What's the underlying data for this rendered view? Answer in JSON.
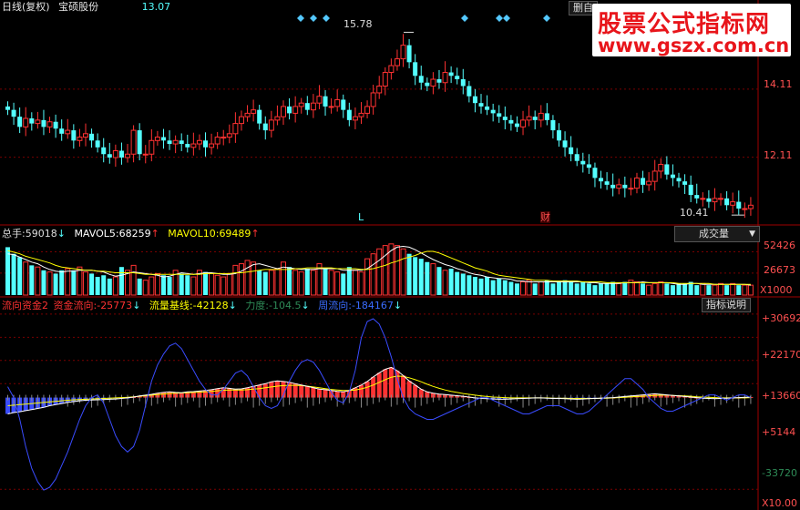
{
  "header": {
    "period": "日线(复权)",
    "stock_name": "宝硕股份",
    "price_value": "13.07",
    "right_button": "删自"
  },
  "main_panel": {
    "y_ticks": [
      "14.11",
      "12.11"
    ],
    "high_label": "15.78",
    "low_label": "10.41",
    "marker_L": "L",
    "marker_cai": "财"
  },
  "volume_panel": {
    "label_total": "总手:",
    "total_value": "59018",
    "label_ma5": "MAVOL5:",
    "ma5_value": "68259",
    "label_ma10": "MAVOL10:",
    "ma10_value": "69489",
    "dropdown": "成交量",
    "y_ticks": [
      "52426",
      "26673"
    ],
    "unit": "X1000"
  },
  "indicator_panel": {
    "label_fund2": "流向资金2",
    "label_flow": "资金流向:",
    "flow_value": "-25773",
    "label_base": "流量基线:",
    "base_value": "-42128",
    "label_force": "力度:",
    "force_value": "-104.5",
    "label_week": "周流向:",
    "week_value": "-184167",
    "explain_button": "指标说明",
    "y_ticks": [
      "+30692",
      "+22170",
      "+13660",
      "+5144",
      "-33720"
    ],
    "unit": "X10.00"
  },
  "watermark": {
    "line1": "股票公式指标网",
    "line2": "www.gszx.com.cn"
  },
  "colors": {
    "up": "#ff3232",
    "down": "#54ffff",
    "ma5": "#ffffff",
    "ma10": "#ffff00",
    "week": "#3a4cff",
    "grid": "#7a0000",
    "arrow_up": "#ff3232",
    "arrow_down": "#54ffff"
  },
  "chart_data": [
    {
      "type": "candlestick",
      "title": "日线(复权) 宝硕股份",
      "close": [
        13.5,
        13.3,
        13.0,
        13.25,
        13.1,
        13.2,
        13.0,
        13.15,
        12.95,
        12.8,
        12.9,
        12.6,
        12.7,
        12.8,
        12.6,
        12.4,
        12.2,
        12.1,
        12.3,
        12.1,
        12.2,
        12.9,
        12.2,
        12.2,
        12.6,
        12.7,
        12.6,
        12.5,
        12.6,
        12.5,
        12.4,
        12.5,
        12.6,
        12.4,
        12.5,
        12.7,
        12.7,
        12.8,
        13.1,
        13.3,
        13.4,
        13.5,
        13.1,
        12.9,
        13.2,
        13.3,
        13.6,
        13.4,
        13.6,
        13.7,
        13.5,
        13.7,
        13.9,
        13.6,
        13.6,
        13.8,
        13.5,
        13.2,
        13.3,
        13.4,
        13.6,
        14.0,
        14.2,
        14.6,
        14.8,
        15.0,
        15.4,
        14.9,
        14.5,
        14.3,
        14.2,
        14.4,
        14.3,
        14.6,
        14.5,
        14.4,
        14.2,
        13.9,
        13.7,
        13.6,
        13.5,
        13.4,
        13.3,
        13.2,
        13.1,
        13.0,
        13.2,
        13.3,
        13.2,
        13.4,
        13.2,
        12.9,
        12.6,
        12.4,
        12.2,
        12.0,
        11.9,
        11.8,
        11.5,
        11.4,
        11.3,
        11.2,
        11.3,
        11.2,
        11.2,
        11.5,
        11.3,
        11.4,
        11.7,
        11.9,
        11.6,
        11.5,
        11.4,
        11.3,
        11.0,
        10.9,
        10.9,
        10.8,
        10.9,
        10.9,
        10.7,
        10.8,
        10.6,
        10.6,
        10.7
      ],
      "markers": {
        "high": 15.78,
        "low": 10.41
      },
      "y_ticks": [
        14.11,
        12.11
      ]
    },
    {
      "type": "bar",
      "title": "成交量",
      "unit": "X1000",
      "values": [
        58,
        50,
        46,
        40,
        36,
        34,
        30,
        28,
        26,
        30,
        32,
        30,
        34,
        28,
        26,
        22,
        24,
        20,
        22,
        34,
        30,
        36,
        20,
        18,
        22,
        26,
        24,
        22,
        30,
        26,
        24,
        22,
        30,
        28,
        26,
        24,
        22,
        26,
        36,
        38,
        42,
        40,
        30,
        28,
        30,
        32,
        40,
        34,
        30,
        28,
        32,
        30,
        38,
        32,
        30,
        28,
        26,
        34,
        30,
        28,
        44,
        50,
        56,
        60,
        62,
        60,
        56,
        50,
        46,
        44,
        40,
        38,
        34,
        30,
        32,
        28,
        26,
        24,
        22,
        20,
        22,
        18,
        20,
        18,
        16,
        14,
        16,
        18,
        14,
        16,
        18,
        14,
        16,
        18,
        16,
        14,
        16,
        14,
        12,
        14,
        14,
        16,
        14,
        16,
        18,
        16,
        14,
        12,
        14,
        16,
        14,
        12,
        14,
        14,
        16,
        12,
        14,
        12,
        12,
        14,
        12,
        14,
        12,
        12,
        12
      ],
      "ma5": [
        50,
        49,
        46,
        43,
        40,
        38,
        34,
        31,
        29,
        28,
        29,
        29,
        30,
        30,
        30,
        29,
        28,
        25,
        23,
        24,
        26,
        28,
        27,
        26,
        25,
        24,
        22,
        23,
        25,
        27,
        26,
        25,
        26,
        27,
        27,
        26,
        25,
        25,
        26,
        29,
        33,
        37,
        38,
        36,
        34,
        32,
        34,
        33,
        32,
        31,
        31,
        31,
        32,
        32,
        32,
        32,
        30,
        30,
        30,
        30,
        32,
        37,
        42,
        48,
        54,
        58,
        59,
        58,
        55,
        51,
        47,
        43,
        40,
        37,
        35,
        32,
        30,
        27,
        25,
        24,
        22,
        21,
        20,
        20,
        19,
        17,
        17,
        16,
        16,
        16,
        16,
        16,
        16,
        16,
        16,
        16,
        16,
        15,
        15,
        14,
        14,
        14,
        14,
        15,
        15,
        15,
        16,
        15,
        15,
        15,
        15,
        14,
        13,
        13,
        14,
        14,
        13,
        13,
        13,
        13,
        13,
        13,
        13,
        13,
        12
      ],
      "ma10": [
        54,
        52,
        50,
        47,
        45,
        43,
        41,
        39,
        36,
        34,
        33,
        32,
        31,
        30,
        30,
        29,
        29,
        28,
        27,
        27,
        27,
        27,
        26,
        25,
        25,
        25,
        25,
        25,
        25,
        25,
        25,
        25,
        25,
        26,
        26,
        26,
        26,
        26,
        27,
        27,
        28,
        29,
        30,
        31,
        31,
        31,
        31,
        31,
        32,
        32,
        33,
        33,
        33,
        33,
        33,
        32,
        32,
        32,
        32,
        31,
        31,
        32,
        34,
        36,
        39,
        41,
        44,
        46,
        48,
        51,
        53,
        53,
        51,
        48,
        45,
        42,
        39,
        36,
        33,
        31,
        29,
        26,
        24,
        23,
        22,
        21,
        20,
        19,
        18,
        18,
        18,
        17,
        17,
        17,
        17,
        17,
        16,
        16,
        16,
        16,
        15,
        15,
        15,
        15,
        15,
        15,
        15,
        15,
        15,
        15,
        15,
        15,
        14,
        14,
        14,
        14,
        14,
        14,
        13,
        13,
        13,
        13,
        13,
        13,
        13
      ],
      "y_ticks": [
        52426,
        26673
      ]
    },
    {
      "type": "line",
      "title": "流向资金2",
      "unit": "X10.00",
      "series": [
        {
          "name": "资金流向",
          "values": [
            -6000,
            -5500,
            -5200,
            -4800,
            -4400,
            -4000,
            -3600,
            -3000,
            -2600,
            -2200,
            -1800,
            -1500,
            -1200,
            -1000,
            -900,
            -800,
            -700,
            -600,
            -500,
            -300,
            -100,
            200,
            600,
            900,
            1200,
            1600,
            1900,
            2100,
            1900,
            1800,
            2100,
            2200,
            2400,
            2600,
            2900,
            3300,
            3600,
            3400,
            3100,
            3200,
            3600,
            4100,
            4600,
            5100,
            5800,
            6100,
            5900,
            5600,
            5100,
            4600,
            4100,
            3600,
            3100,
            2900,
            2600,
            2300,
            2100,
            2600,
            3600,
            4600,
            5900,
            7600,
            9100,
            10400,
            11100,
            9900,
            8100,
            6100,
            4600,
            3100,
            2100,
            1600,
            1300,
            1100,
            900,
            700,
            500,
            200,
            -100,
            -300,
            -400,
            -500,
            -600,
            -600,
            -500,
            -400,
            -300,
            -200,
            -100,
            -100,
            -200,
            -300,
            -300,
            -400,
            -500,
            -600,
            -500,
            -400,
            -300,
            -200,
            -100,
            0,
            200,
            400,
            600,
            800,
            1000,
            1200,
            1400,
            1200,
            1000,
            800,
            600,
            400,
            200,
            0,
            -200,
            -300,
            -400,
            -300,
            -200,
            -100,
            0,
            100,
            200
          ]
        },
        {
          "name": "流量基线",
          "values": [
            -3000,
            -2800,
            -2600,
            -2400,
            -2200,
            -2000,
            -1800,
            -1600,
            -1400,
            -1200,
            -1000,
            -800,
            -700,
            -600,
            -500,
            -400,
            -300,
            -200,
            -100,
            0,
            100,
            300,
            500,
            700,
            900,
            1100,
            1300,
            1500,
            1600,
            1700,
            1800,
            1900,
            2000,
            2100,
            2300,
            2500,
            2700,
            2800,
            2800,
            2800,
            2900,
            3100,
            3300,
            3600,
            3900,
            4200,
            4400,
            4500,
            4500,
            4400,
            4200,
            3900,
            3600,
            3300,
            3000,
            2800,
            2600,
            2600,
            2800,
            3200,
            3800,
            4600,
            5600,
            6600,
            7500,
            7900,
            7800,
            7300,
            6600,
            5800,
            4900,
            4100,
            3400,
            2800,
            2300,
            1900,
            1500,
            1200,
            900,
            600,
            400,
            200,
            100,
            0,
            -100,
            -100,
            -100,
            -100,
            -100,
            -100,
            -100,
            -200,
            -200,
            -200,
            -300,
            -300,
            -300,
            -300,
            -300,
            -200,
            -200,
            -100,
            0,
            100,
            300,
            400,
            500,
            700,
            800,
            900,
            900,
            800,
            700,
            600,
            500,
            300,
            200,
            100,
            0,
            -100,
            -100,
            -100,
            -100,
            -100,
            0
          ]
        },
        {
          "name": "周流向",
          "values": [
            4000,
            0,
            -8000,
            -18000,
            -26000,
            -31000,
            -34000,
            -33000,
            -30000,
            -25000,
            -20000,
            -14000,
            -8000,
            -3000,
            0,
            1000,
            -2000,
            -8000,
            -14000,
            -18000,
            -20000,
            -18000,
            -12000,
            -3000,
            6000,
            12000,
            16000,
            19000,
            20000,
            18000,
            14000,
            10000,
            6000,
            3000,
            1000,
            1000,
            3000,
            6000,
            9000,
            10000,
            8000,
            4000,
            0,
            -3000,
            -4000,
            -3000,
            1000,
            6000,
            10000,
            13000,
            14000,
            13000,
            10000,
            6000,
            2000,
            -1000,
            -2000,
            2000,
            10000,
            22000,
            28000,
            29000,
            27000,
            22000,
            15000,
            7000,
            0,
            -4000,
            -6000,
            -7000,
            -8000,
            -8000,
            -7000,
            -6000,
            -5000,
            -4000,
            -3000,
            -2000,
            -1000,
            0,
            0,
            -1000,
            -2000,
            -3000,
            -4000,
            -5000,
            -6000,
            -6000,
            -5000,
            -4000,
            -3000,
            -3000,
            -3000,
            -4000,
            -5000,
            -6000,
            -6000,
            -5000,
            -3000,
            -1000,
            1000,
            3000,
            5000,
            7000,
            7000,
            5000,
            3000,
            0,
            -2000,
            -4000,
            -5000,
            -5000,
            -4000,
            -3000,
            -2000,
            -1000,
            0,
            1000,
            1000,
            0,
            -1000,
            0,
            1000,
            1000,
            0
          ]
        }
      ],
      "y_ticks": [
        30692,
        22170,
        13660,
        5144,
        -33720
      ]
    }
  ]
}
